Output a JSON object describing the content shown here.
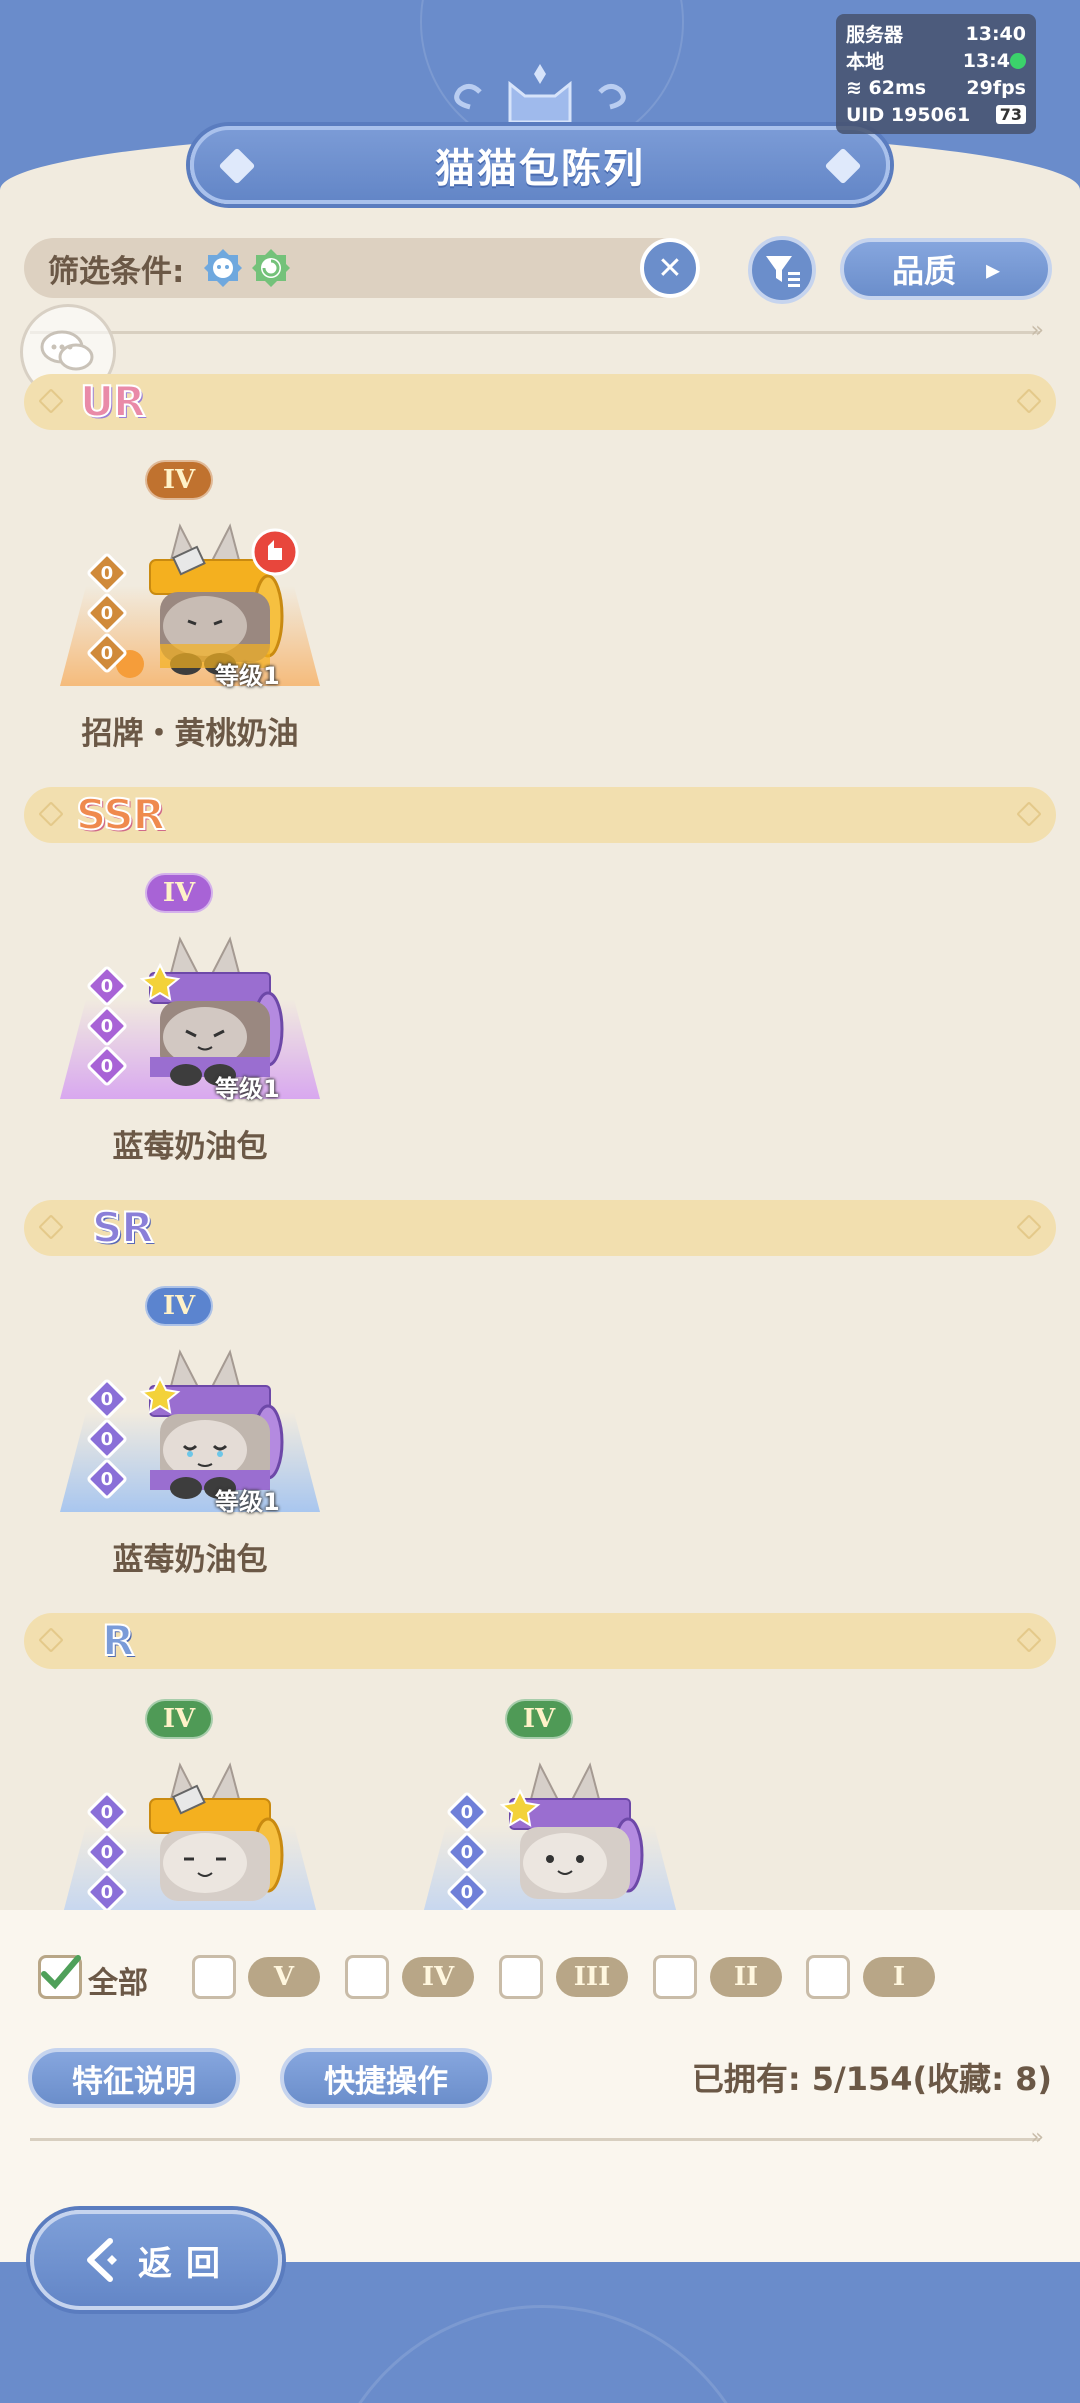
{
  "status": {
    "server_label": "服务器",
    "server_time": "13:40",
    "local_label": "本地",
    "local_time": "13:4",
    "ping": "62ms",
    "fps": "29fps",
    "uid_label": "UID",
    "uid": "195061",
    "battery": "73"
  },
  "title": "猫猫包陈列",
  "filter": {
    "label": "筛选条件:",
    "quality_button": "品质"
  },
  "sections": [
    {
      "rarity": "UR",
      "color": "#e88aa8",
      "cards": [
        {
          "tier": "IV",
          "tier_color": "#c0722f",
          "name": "招牌・黄桃奶油",
          "level": "等级1",
          "pips": [
            "0",
            "0",
            "0"
          ],
          "pip_color": "#d08a3a",
          "glow": "#f6b36a"
        }
      ]
    },
    {
      "rarity": "SSR",
      "color": "#ef8a4e",
      "cards": [
        {
          "tier": "IV",
          "tier_color": "#a863d6",
          "name": "蓝莓奶油包",
          "level": "等级1",
          "pips": [
            "0",
            "0",
            "0"
          ],
          "pip_color": "#a863d6",
          "glow": "#d49cf2"
        }
      ]
    },
    {
      "rarity": "SR",
      "color": "#8a7fd8",
      "cards": [
        {
          "tier": "IV",
          "tier_color": "#5b84cf",
          "name": "蓝莓奶油包",
          "level": "等级1",
          "pips": [
            "0",
            "0",
            "0"
          ],
          "pip_color": "#8a6fd8",
          "glow": "#9cc0f2"
        }
      ]
    },
    {
      "rarity": "R",
      "color": "#6b8ecb",
      "cards": [
        {
          "tier": "IV",
          "tier_color": "#4f9a56",
          "pips": [
            "0",
            "0",
            "0"
          ],
          "pip_color": "#8a6fd8",
          "glow": "#b8d0f5"
        },
        {
          "tier": "IV",
          "tier_color": "#4f9a56",
          "pips": [
            "0",
            "0",
            "0"
          ],
          "pip_color": "#6f7fd8",
          "glow": "#b8d0f5"
        }
      ]
    }
  ],
  "bottom": {
    "all_label": "全部",
    "grades": [
      "V",
      "IV",
      "III",
      "II",
      "I"
    ],
    "feature_button": "特征说明",
    "quick_button": "快捷操作",
    "owned": "已拥有: 5/154(收藏: 8)",
    "back": "返回"
  },
  "colors": {
    "accent_blue": "#6b8ecb",
    "panel_cream": "#f1ebdf",
    "rarity_bar": "#f2dfaf",
    "text_brown": "#6b5846"
  }
}
